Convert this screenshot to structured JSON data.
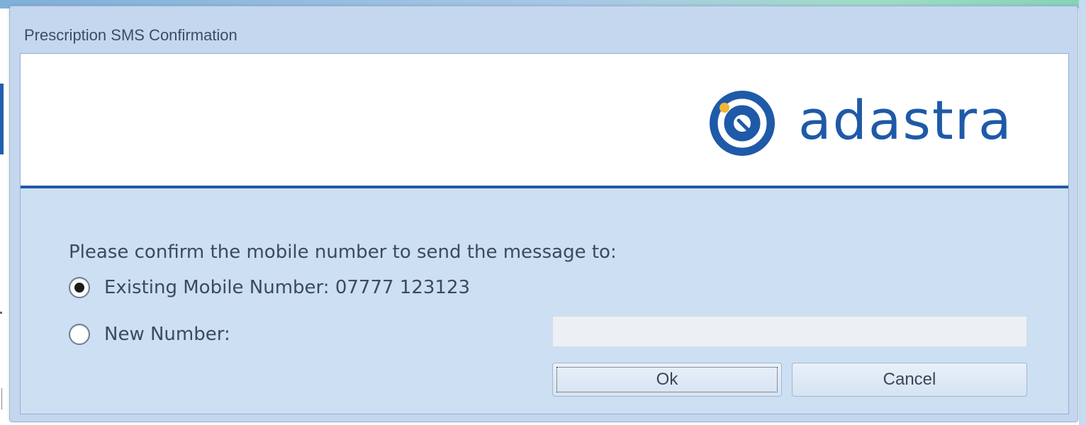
{
  "dialog": {
    "title": "Prescription SMS Confirmation"
  },
  "banner": {
    "logo_icon": "adastra-logo-icon",
    "logo_text": "adastra",
    "brand_color": "#1e5aa8"
  },
  "form": {
    "prompt": "Please confirm the mobile number to send the message to:",
    "options": [
      {
        "label": "Existing Mobile Number: 07777 123123",
        "selected": true
      },
      {
        "label": "New Number:",
        "selected": false
      }
    ],
    "new_number": {
      "value": "",
      "placeholder": ""
    }
  },
  "buttons": {
    "ok_label": "Ok",
    "cancel_label": "Cancel"
  }
}
